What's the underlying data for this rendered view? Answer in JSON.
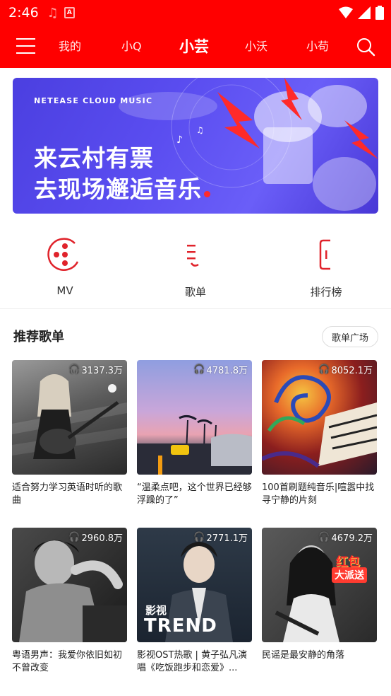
{
  "status_bar": {
    "time": "2:46",
    "notification_icon": "music-note-icon",
    "app_icon": "a-icon"
  },
  "nav": {
    "tabs": [
      {
        "label": "我的"
      },
      {
        "label": "小Q"
      },
      {
        "label": "小芸",
        "active": true
      },
      {
        "label": "小沃"
      },
      {
        "label": "小苟"
      }
    ]
  },
  "banner": {
    "brand": "NETEASE CLOUD MUSIC",
    "line1": "来云村有票",
    "line2": "去现场邂逅音乐"
  },
  "quick_links": [
    {
      "label": "MV",
      "icon": "mv-disc-icon"
    },
    {
      "label": "歌单",
      "icon": "playlist-icon"
    },
    {
      "label": "排行榜",
      "icon": "chart-phone-icon"
    }
  ],
  "section": {
    "title": "推荐歌单",
    "more_button": "歌单广场"
  },
  "playlists": [
    {
      "count": "3137.3万",
      "title": "适合努力学习英语时听的歌曲"
    },
    {
      "count": "4781.8万",
      "title": "“温柔点吧，这个世界已经够浮躁的了”"
    },
    {
      "count": "8052.1万",
      "title": "100首刷题纯音乐|喧嚣中找寻宁静的片刻"
    },
    {
      "count": "2960.8万",
      "title": "粤语男声：我爱你依旧如初不曾改变"
    },
    {
      "count": "2771.1万",
      "title": "影视OST热歌 | 黄子弘凡演唱《吃饭跑步和恋爱》...",
      "cover_text1": "影视",
      "cover_text2": "TREND"
    },
    {
      "count": "4679.2万",
      "title": "民谣是最安静的角落",
      "cover_text1": "红包",
      "cover_text2": "大派送"
    }
  ],
  "colors": {
    "brand_red": "#ff0000",
    "banner_blue": "#5a4df0"
  }
}
